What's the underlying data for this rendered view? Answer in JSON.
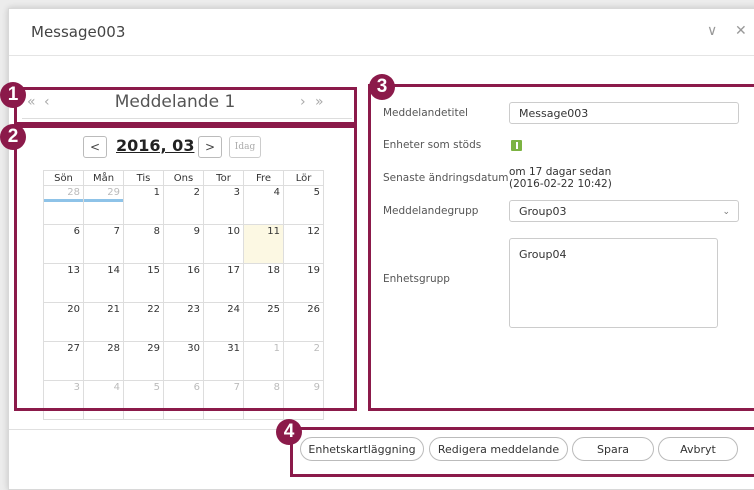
{
  "dialog": {
    "title": "Message003",
    "minimize_glyph": "∨",
    "close_glyph": "✕"
  },
  "callouts": [
    "1",
    "2",
    "3",
    "4"
  ],
  "message_nav": {
    "first_glyph": "«",
    "prev_glyph": "‹",
    "title": "Meddelande 1",
    "next_glyph": "›",
    "last_glyph": "»"
  },
  "calendar": {
    "prev_glyph": "<",
    "month_label": "2016, 03",
    "next_glyph": ">",
    "today_label": "Idag",
    "weekdays": [
      "Sön",
      "Mån",
      "Tis",
      "Ons",
      "Tor",
      "Fre",
      "Lör"
    ],
    "weeks": [
      [
        "28",
        "29",
        "1",
        "2",
        "3",
        "4",
        "5"
      ],
      [
        "6",
        "7",
        "8",
        "9",
        "10",
        "11",
        "12"
      ],
      [
        "13",
        "14",
        "15",
        "16",
        "17",
        "18",
        "19"
      ],
      [
        "20",
        "21",
        "22",
        "23",
        "24",
        "25",
        "26"
      ],
      [
        "27",
        "28",
        "29",
        "30",
        "31",
        "1",
        "2"
      ],
      [
        "3",
        "4",
        "5",
        "6",
        "7",
        "8",
        "9"
      ]
    ],
    "highlighted_day": "11",
    "event_bar_color": "#8ec3e8"
  },
  "form": {
    "title_label": "Meddelandetitel",
    "title_value": "Message003",
    "supported_label": "Enheter som stöds",
    "supported_color": "#7cb342",
    "modified_label": "Senaste ändringsdatum",
    "modified_line1": "om 17 dagar sedan",
    "modified_line2": "(2016-02-22 10:42)",
    "group_label": "Meddelandegrupp",
    "group_value": "Group03",
    "device_group_label": "Enhetsgrupp",
    "device_group_value": "Group04"
  },
  "footer": {
    "mapping_button": "Enhetskartläggning",
    "edit_button": "Redigera meddelande",
    "save_button": "Spara",
    "cancel_button": "Avbryt"
  },
  "accent_color": "#8b1a4a"
}
